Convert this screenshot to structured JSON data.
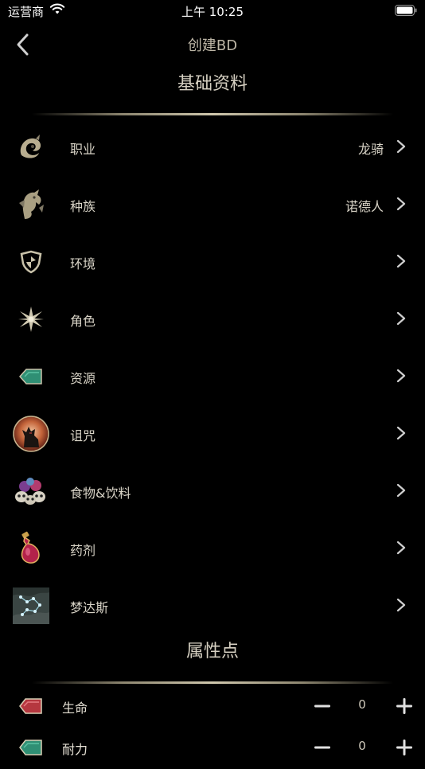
{
  "status_bar": {
    "carrier": "运营商",
    "time": "上午 10:25"
  },
  "nav": {
    "title": "创建BD"
  },
  "basic_section": {
    "title": "基础资料"
  },
  "basic_items": [
    {
      "label": "职业",
      "value": "龙骑",
      "icon": "dragon-emblem-icon"
    },
    {
      "label": "种族",
      "value": "诺德人",
      "icon": "dragon-crest-icon"
    },
    {
      "label": "环境",
      "value": "",
      "icon": "shield-icon"
    },
    {
      "label": "角色",
      "value": "",
      "icon": "star-burst-icon"
    },
    {
      "label": "资源",
      "value": "",
      "icon": "teal-tag-icon"
    },
    {
      "label": "诅咒",
      "value": "",
      "icon": "werewolf-curse-icon"
    },
    {
      "label": "食物&饮料",
      "value": "",
      "icon": "food-drinks-icon"
    },
    {
      "label": "药剂",
      "value": "",
      "icon": "potion-icon"
    },
    {
      "label": "梦达斯",
      "value": "",
      "icon": "mundus-map-icon"
    }
  ],
  "attributes_section": {
    "title": "属性点"
  },
  "attributes": [
    {
      "label": "生命",
      "value": "0",
      "color": "#b5373f"
    },
    {
      "label": "耐力",
      "value": "0",
      "color": "#2f8f74"
    }
  ],
  "colors": {
    "background": "#000000",
    "accent_gold": "#cfc7ad",
    "text": "#d9d4c7"
  }
}
